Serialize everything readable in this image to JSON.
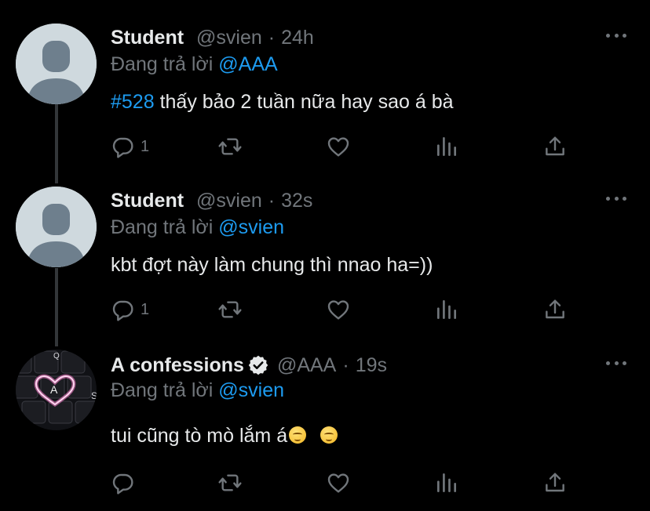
{
  "tweets": [
    {
      "name": "Student",
      "handle": "@svien",
      "dot": "·",
      "time": "24h",
      "replying_prefix": "Đang trả lời",
      "replying_to": "@AAA",
      "hashtag": "#528",
      "text": " thấy bảo 2 tuần nữa hay sao á bà",
      "reply_count": "1",
      "verified": false
    },
    {
      "name": "Student",
      "handle": "@svien",
      "dot": "·",
      "time": "32s",
      "replying_prefix": "Đang trả lời",
      "replying_to": "@svien",
      "text": "kbt đợt này làm chung thì nnao ha=))",
      "reply_count": "1",
      "verified": false
    },
    {
      "name": "A confessions",
      "handle": "@AAA",
      "dot": "·",
      "time": "19s",
      "replying_prefix": "Đang trả lời",
      "replying_to": "@svien",
      "text": "tui cũng tò mò lắm á",
      "emoji": "pensive-face",
      "reply_count": "",
      "verified": true
    }
  ],
  "icons": {
    "reply": "reply-icon",
    "retweet": "retweet-icon",
    "like": "heart-icon",
    "analytics": "analytics-icon",
    "share": "share-icon",
    "more": "more-icon",
    "verified": "verified-badge-icon"
  },
  "colors": {
    "background": "#000000",
    "text": "#e7e9ea",
    "muted": "#71767b",
    "accent": "#1d9bf0",
    "thread_line": "#333639"
  }
}
